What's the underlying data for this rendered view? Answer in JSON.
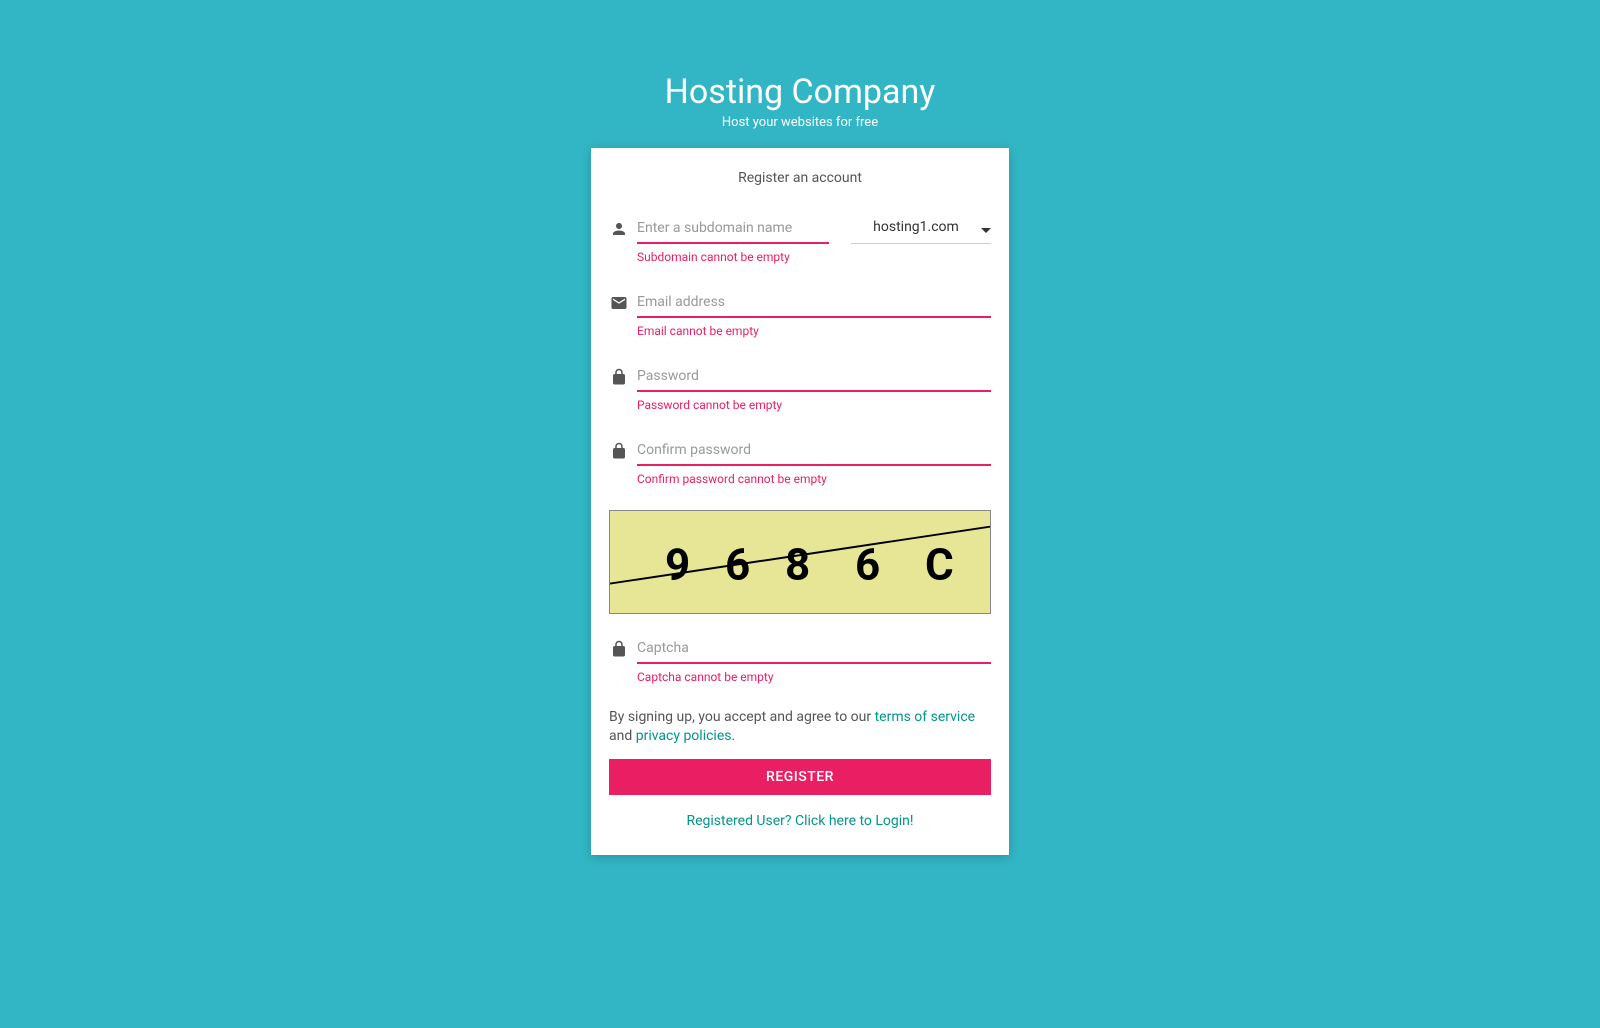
{
  "header": {
    "title": "Hosting Company",
    "subtitle": "Host your websites for free"
  },
  "card": {
    "title": "Register an account"
  },
  "form": {
    "subdomain": {
      "placeholder": "Enter a subdomain name",
      "error": "Subdomain cannot be empty"
    },
    "domain_select": {
      "value": "hosting1.com"
    },
    "email": {
      "placeholder": "Email address",
      "error": "Email cannot be empty"
    },
    "password": {
      "placeholder": "Password",
      "error": "Password cannot be empty"
    },
    "confirm": {
      "placeholder": "Confirm password",
      "error": "Confirm password cannot be empty"
    },
    "captcha": {
      "text": "9686C",
      "placeholder": "Captcha",
      "error": "Captcha cannot be empty"
    }
  },
  "legal": {
    "prefix": "By signing up, you accept and agree to our ",
    "tos": "terms of service",
    "and": " and ",
    "privacy": "privacy policies",
    "suffix": "."
  },
  "buttons": {
    "register": "REGISTER"
  },
  "login_link": "Registered User? Click here to Login!"
}
